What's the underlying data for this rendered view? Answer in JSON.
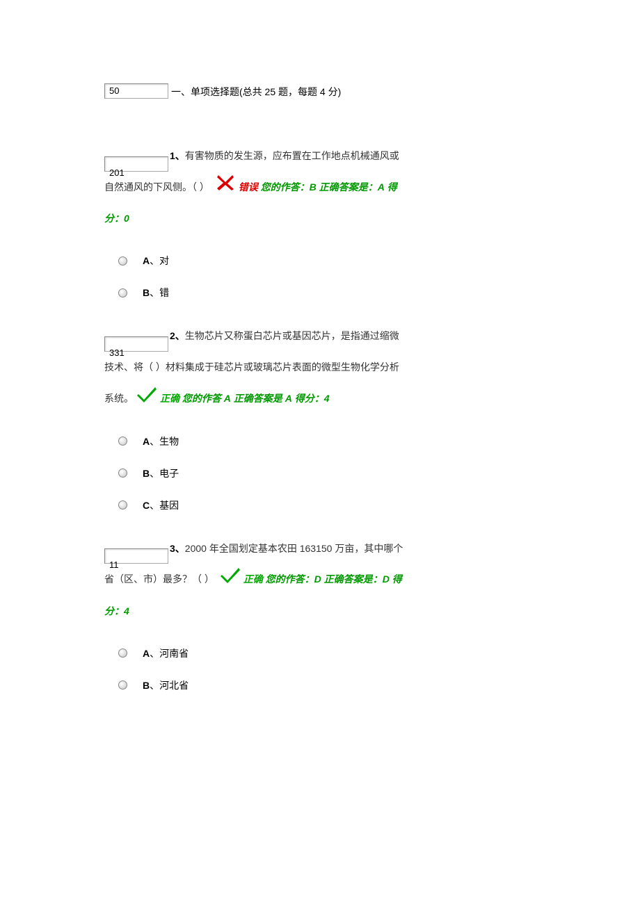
{
  "section": {
    "boxValue": "50",
    "title": "一、单项选择题(总共 25 题，每题 4 分)"
  },
  "questions": [
    {
      "boxValue": "201",
      "number": "1、",
      "textA": "有害物质的发生源，应布置在工作地点机械通风或自然通风的下风侧。（ ） ",
      "resultIcon": "wrong",
      "resultLabel": "错误",
      "yourAnswerPrefix": " 您的作答：",
      "yourAnswer": "B",
      "correctPrefix": " 正确答案是：",
      "correctAnswer": "A",
      "scorePrefix": " 得分：",
      "score": "0",
      "options": [
        {
          "letter": "A",
          "sep": "、",
          "text": "对"
        },
        {
          "letter": "B",
          "sep": "、",
          "text": "错"
        }
      ]
    },
    {
      "boxValue": "331",
      "number": "2、",
      "textA": "生物芯片又称蛋白芯片或基因芯片，是指通过缩微技术、将（ ）材料集成于硅芯片或玻璃芯片表面的微型生物化学分析系统。",
      "resultIcon": "correct",
      "resultLabel": "正确",
      "yourAnswerPrefix": " 您的作答 ",
      "yourAnswer": "A",
      "correctPrefix": " 正确答案是 ",
      "correctAnswer": "A",
      "scorePrefix": " 得分：",
      "score": "4",
      "options": [
        {
          "letter": "A",
          "sep": "、",
          "text": "生物"
        },
        {
          "letter": "B",
          "sep": "、",
          "text": "电子"
        },
        {
          "letter": "C",
          "sep": "、",
          "text": "基因"
        }
      ]
    },
    {
      "boxValue": "11",
      "number": "3、",
      "textA": "2000 年全国划定基本农田 163150 万亩，其中哪个省（区、市）最多？（ ） ",
      "resultIcon": "correct",
      "resultLabel": "正确",
      "yourAnswerPrefix": " 您的作答：",
      "yourAnswer": "D",
      "correctPrefix": " 正确答案是：",
      "correctAnswer": "D",
      "scorePrefix": " 得分：",
      "score": "4",
      "options": [
        {
          "letter": "A",
          "sep": "、",
          "text": "河南省"
        },
        {
          "letter": "B",
          "sep": "、",
          "text": "河北省"
        }
      ]
    }
  ]
}
